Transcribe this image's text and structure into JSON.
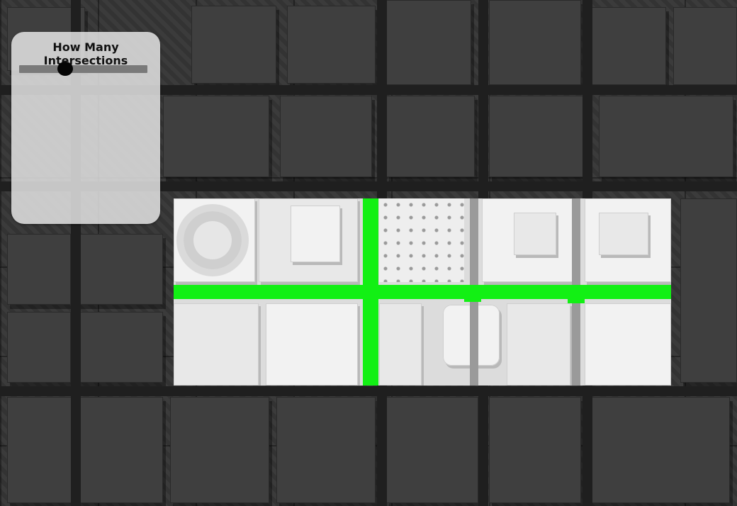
{
  "control_panel": {
    "title": "How Many Intersections",
    "slider": {
      "level_fraction": 0.36
    }
  },
  "colors": {
    "route": "#12f014",
    "panel_bg": "rgba(235,235,235,0.82)",
    "slider_track": "#7a7a7a",
    "slider_thumb": "#050505"
  }
}
